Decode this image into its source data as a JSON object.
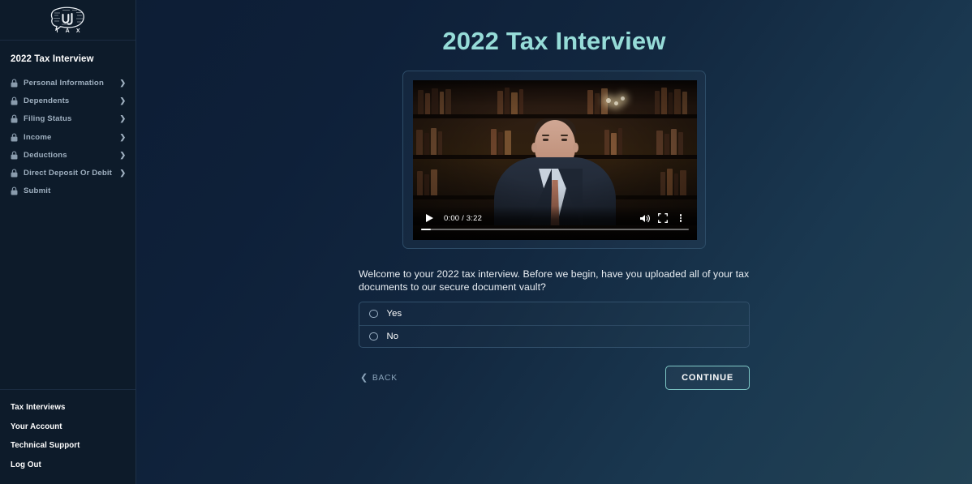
{
  "brand": {
    "logo_icon": "brain-speech-bubble-logo",
    "logo_wordmark": "T A X"
  },
  "sidebar": {
    "nav_title": "2022 Tax Interview",
    "items": [
      {
        "label": "Personal Information",
        "lock_icon": "lock-icon",
        "chevron_icon": "chevron-right-icon",
        "has_chevron": true
      },
      {
        "label": "Dependents",
        "lock_icon": "lock-icon",
        "chevron_icon": "chevron-right-icon",
        "has_chevron": true
      },
      {
        "label": "Filing Status",
        "lock_icon": "lock-icon",
        "chevron_icon": "chevron-right-icon",
        "has_chevron": true
      },
      {
        "label": "Income",
        "lock_icon": "lock-icon",
        "chevron_icon": "chevron-right-icon",
        "has_chevron": true
      },
      {
        "label": "Deductions",
        "lock_icon": "lock-icon",
        "chevron_icon": "chevron-right-icon",
        "has_chevron": true
      },
      {
        "label": "Direct Deposit Or Debit",
        "lock_icon": "lock-icon",
        "chevron_icon": "chevron-right-icon",
        "has_chevron": true
      },
      {
        "label": "Submit",
        "lock_icon": "lock-icon",
        "chevron_icon": "",
        "has_chevron": false
      }
    ],
    "footer_links": [
      {
        "label": "Tax Interviews"
      },
      {
        "label": "Your Account"
      },
      {
        "label": "Technical Support"
      },
      {
        "label": "Log Out"
      }
    ]
  },
  "main": {
    "page_title": "2022 Tax Interview",
    "video": {
      "current_time": "0:00",
      "duration": "3:22",
      "time_display": "0:00 / 3:22",
      "progress_percent": 0,
      "play_icon": "play-icon",
      "volume_icon": "volume-icon",
      "fullscreen_icon": "fullscreen-icon",
      "more_icon": "kebab-menu-icon",
      "scene": "man in navy suit seated in front of a bookshelf"
    },
    "question": {
      "text": "Welcome to your 2022 tax interview. Before we begin, have you uploaded all of your tax documents to our secure document vault?",
      "options": [
        {
          "label": "Yes",
          "selected": false
        },
        {
          "label": "No",
          "selected": false
        }
      ]
    },
    "actions": {
      "back_label": "BACK",
      "back_icon": "chevron-left-icon",
      "continue_label": "CONTINUE"
    }
  },
  "colors": {
    "accent_title": "#96dcd8",
    "accent_border": "#7fc8c6",
    "sidebar_bg": "#0d1b2a",
    "page_bg_start": "#0c1c33",
    "page_bg_end": "#234355",
    "nav_label": "#9fb0c0"
  }
}
